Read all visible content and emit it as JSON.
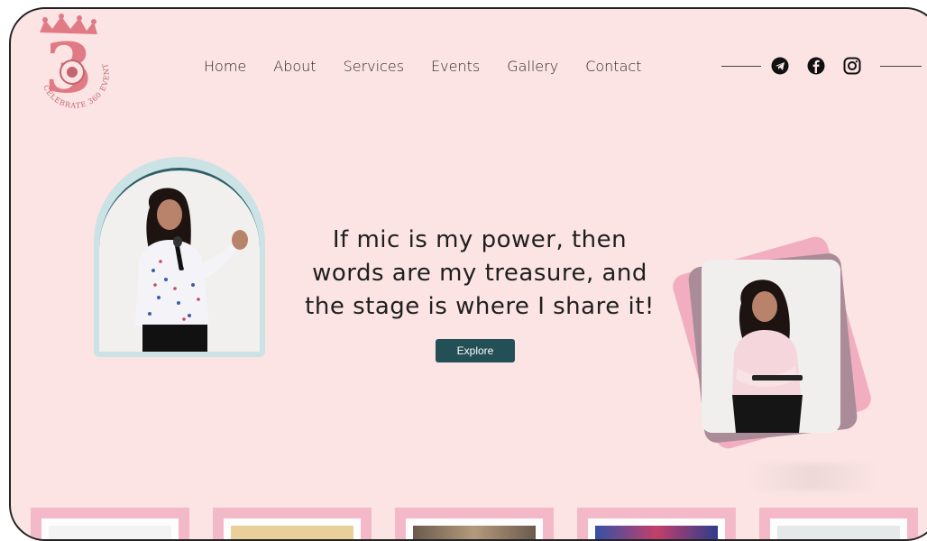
{
  "brand": {
    "logo_numeral": "3",
    "logo_ring_text": "CELEBRATE 360 EVENTS"
  },
  "nav": {
    "items": [
      {
        "label": "Home"
      },
      {
        "label": "About"
      },
      {
        "label": "Services"
      },
      {
        "label": "Events"
      },
      {
        "label": "Gallery"
      },
      {
        "label": "Contact"
      }
    ]
  },
  "social": {
    "icons": [
      "telegram-icon",
      "facebook-icon",
      "instagram-icon"
    ]
  },
  "hero": {
    "headline_lines": [
      "If mic is my power, then",
      "words are my treasure, and",
      "the stage is where I share it!"
    ],
    "cta_label": "Explore"
  },
  "colors": {
    "background": "#fbe4e3",
    "accent": "#234f57",
    "arch": "#cbe3e4",
    "card_pink": "#f2aec1",
    "card_mauve": "#a98c97",
    "logo": "#e07b86"
  }
}
